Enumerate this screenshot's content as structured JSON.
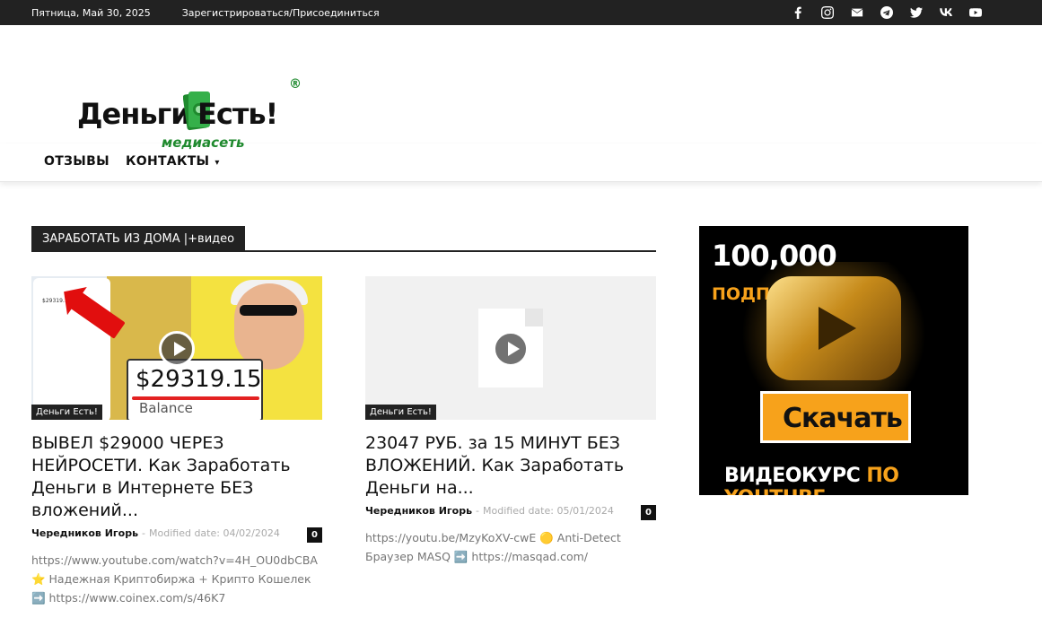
{
  "topbar": {
    "date": "Пятница, Май 30, 2025",
    "register": "Зарегистрироваться/Присоединиться",
    "social": [
      "facebook-icon",
      "instagram-icon",
      "mail-icon",
      "telegram-icon",
      "twitter-icon",
      "vk-icon",
      "youtube-icon"
    ]
  },
  "logo": {
    "word1": "Деньги",
    "word2": "Есть!",
    "sub": "медиасеть",
    "reg": "®"
  },
  "nav": {
    "reviews": "ОТЗЫВЫ",
    "contacts": "КОНТАКТЫ",
    "contacts_chevron": "⌄"
  },
  "section": {
    "title": "ЗАРАБОТАТЬ ИЗ ДОМА |+видео"
  },
  "posts": [
    {
      "category": "Деньги Есть!",
      "title": "ВЫВЕЛ $29000 ЧЕРЕЗ НЕЙРОСЕТИ. Как Заработать Деньги в Интернете БЕЗ вложений...",
      "author": "Чередников Игорь",
      "separator": "-",
      "modified": "Modified date: 04/02/2024",
      "comments": "0",
      "excerpt": "https://www.youtube.com/watch?v=4H_OU0dbCBA ⭐ Надежная Криптобиржа + Крипто Кошелек ➡️ https://www.coinex.com/s/46K7",
      "thumb_balance": "$29319.15",
      "thumb_balance_label": "Balance",
      "thumb_phone_amount": "$29319.15"
    },
    {
      "category": "Деньги Есть!",
      "title": "23047 РУБ. за 15 МИНУТ БЕЗ ВЛОЖЕНИЙ. Как Заработать Деньги на...",
      "author": "Чередников Игорь",
      "separator": "-",
      "modified": "Modified date: 05/01/2024",
      "comments": "0",
      "excerpt": "https://youtu.be/MzyKoXV-cwE 🟡 Anti-Detect Браузер MASQ ➡️ https://masqad.com/"
    }
  ],
  "banner": {
    "count": "100,000",
    "subscribers": "ПОДПИСЧИКОВ",
    "download": "Скачать",
    "course": "ВИДЕОКУРС",
    "by": "ПО YOUTUBE"
  }
}
